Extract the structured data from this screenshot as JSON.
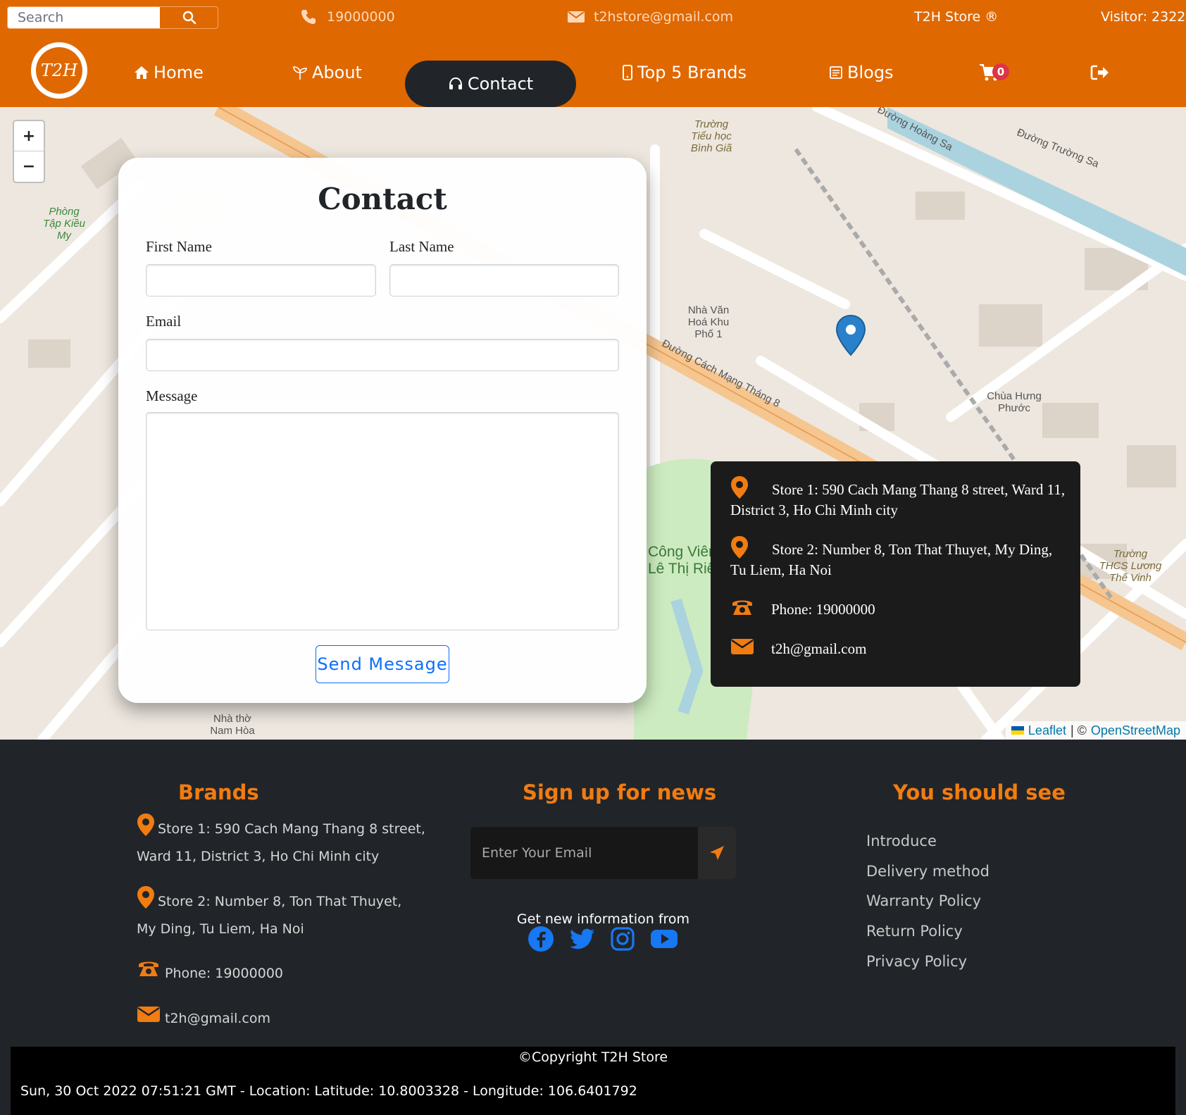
{
  "topbar": {
    "search_placeholder": "Search",
    "phone": "19000000",
    "email": "t2hstore@gmail.com",
    "store_name": "T2H Store ®",
    "visitor": "Visitor: 2322"
  },
  "nav": {
    "logo_text": "T2H",
    "items": [
      {
        "label": "Home",
        "icon": "home-icon"
      },
      {
        "label": "About",
        "icon": "seedling-icon"
      },
      {
        "label": "Contact",
        "icon": "headset-icon"
      },
      {
        "label": "Top 5 Brands",
        "icon": "mobile-icon"
      },
      {
        "label": "Blogs",
        "icon": "newspaper-icon"
      }
    ],
    "cart_count": "0"
  },
  "map": {
    "zoom_in": "+",
    "zoom_out": "−",
    "attribution_leaflet": "Leaflet",
    "attribution_sep": "| ©",
    "attribution_osm": "OpenStreetMap",
    "labels": [
      "Đường Cách Mạng Tháng 8",
      "Đường Hoàng Sa",
      "Đường Trường Sa",
      "Công Viên Lê Thị Riêng",
      "Chùa Hưng Phước",
      "Nhà Văn Hoá Khu Phố 1",
      "Trường Tiểu học Bình Giã",
      "Trường THCS Lương Thế Vinh",
      "Nhà thờ Nam Hòa",
      "Phòng Tập Kiều My"
    ]
  },
  "contact_form": {
    "title": "Contact",
    "first_name_label": "First Name",
    "last_name_label": "Last Name",
    "email_label": "Email",
    "message_label": "Message",
    "submit_label": "Send Message"
  },
  "store_info": {
    "store1": "Store 1: 590 Cach Mang Thang 8 street, Ward 11, District 3, Ho Chi Minh city",
    "store2": "Store 2: Number 8, Ton That Thuyet, My Ding, Tu Liem, Ha Noi",
    "phone": "Phone: 19000000",
    "email": "t2h@gmail.com"
  },
  "footer": {
    "brands_title": "Brands",
    "store1_line1": "Store 1: 590 Cach Mang Thang 8 street,",
    "store1_line2": "Ward 11, District 3, Ho Chi Minh city",
    "store2_line1": "Store 2: Number 8, Ton That Thuyet,",
    "store2_line2": "My Ding, Tu Liem, Ha Noi",
    "phone": "Phone: 19000000",
    "email": "t2h@gmail.com",
    "news_title": "Sign up for news",
    "news_placeholder": "Enter Your Email",
    "news_subtitle": "Get new information from",
    "social": [
      "facebook-icon",
      "twitter-icon",
      "instagram-icon",
      "youtube-icon"
    ],
    "see_title": "You should see",
    "links": [
      "Introduce",
      "Delivery method",
      "Warranty Policy",
      "Return Policy",
      "Privacy Policy"
    ]
  },
  "copyright": {
    "text": "©Copyright T2H Store",
    "status": "Sun, 30 Oct 2022 07:51:21 GMT - Location: Latitude: 10.8003328 - Longitude: 106.6401792"
  },
  "colors": {
    "brand_orange": "#e06800",
    "footer_heading": "#f07c12",
    "dark": "#212529",
    "social_blue": "#1877f2"
  }
}
